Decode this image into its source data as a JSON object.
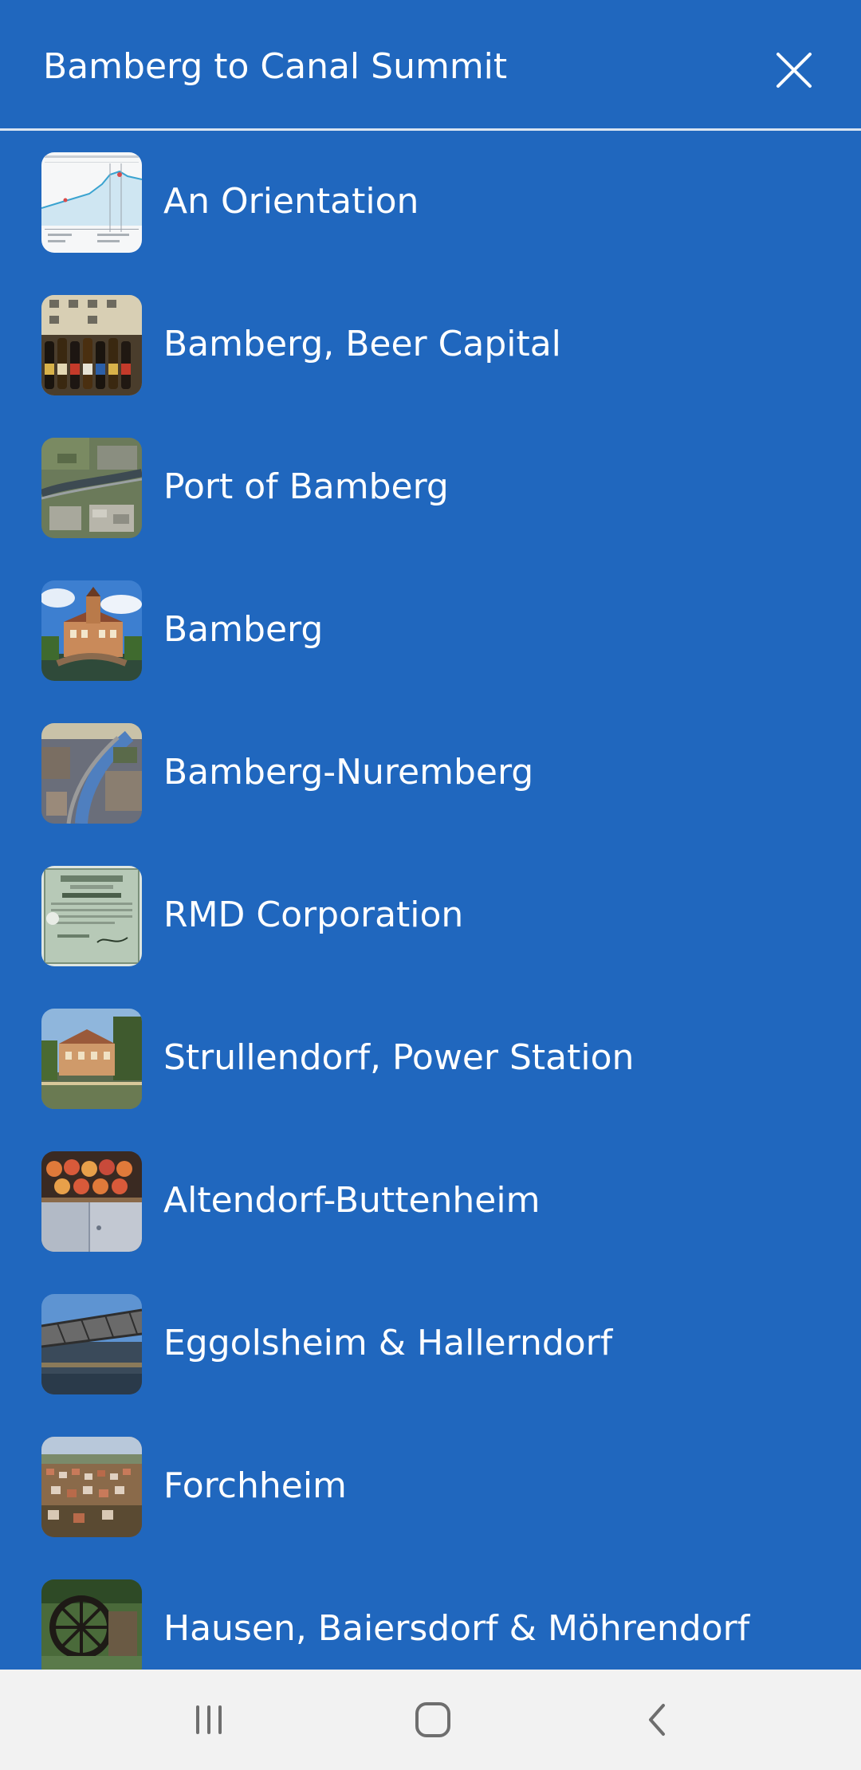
{
  "header": {
    "title": "Bamberg to Canal Summit",
    "close_icon": "close-icon"
  },
  "chapters": [
    {
      "label": "An Orientation",
      "thumbnail": "elevation-profile-chart"
    },
    {
      "label": "Bamberg, Beer Capital",
      "thumbnail": "beer-bottles-photo"
    },
    {
      "label": "Port of Bamberg",
      "thumbnail": "aerial-port-photo"
    },
    {
      "label": "Bamberg",
      "thumbnail": "old-town-hall-photo"
    },
    {
      "label": "Bamberg-Nuremberg",
      "thumbnail": "canal-aerial-photo"
    },
    {
      "label": "RMD Corporation",
      "thumbnail": "share-certificate-photo"
    },
    {
      "label": "Strullendorf, Power Station",
      "thumbnail": "power-station-photo"
    },
    {
      "label": "Altendorf-Buttenheim",
      "thumbnail": "jeans-and-jars-photo"
    },
    {
      "label": "Eggolsheim & Hallerndorf",
      "thumbnail": "bridge-photo"
    },
    {
      "label": "Forchheim",
      "thumbnail": "town-aerial-photo"
    },
    {
      "label": "Hausen, Baiersdorf & Möhrendorf",
      "thumbnail": "waterwheel-photo"
    }
  ],
  "navbar": {
    "recents_icon": "recent-apps-icon",
    "home_icon": "home-icon",
    "back_icon": "back-icon"
  },
  "colors": {
    "background": "#2067be",
    "divider": "#d9e4f2",
    "navbar": "#f2f2f2",
    "text": "#ffffff"
  }
}
